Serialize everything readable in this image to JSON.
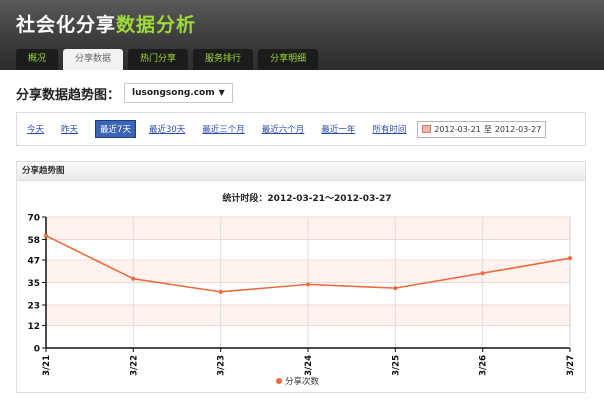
{
  "header": {
    "brand_part1": "社会化分享",
    "brand_part2": "数据分析",
    "tabs": [
      {
        "label": "概况"
      },
      {
        "label": "分享数据"
      },
      {
        "label": "热门分享"
      },
      {
        "label": "服务排行"
      },
      {
        "label": "分享明细"
      }
    ],
    "active_tab": "分享数据"
  },
  "title_row": {
    "title": "分享数据趋势图：",
    "site_selected": "lusongsong.com",
    "caret": "▼"
  },
  "filters": {
    "ranges": [
      "今天",
      "昨天",
      "最近7天",
      "最近30天",
      "最近三个月",
      "最近六个月",
      "最近一年",
      "所有时间"
    ],
    "active_range": "最近7天",
    "date_from": "2012-03-21",
    "date_to_label": "至",
    "date_to": "2012-03-27"
  },
  "panel": {
    "title": "分享趋势图"
  },
  "colors": {
    "accent_green": "#9ed93a",
    "line": "#ee6a3a",
    "band": "#fff2ef",
    "active_range_bg": "#3b64b4"
  },
  "chart_data": {
    "type": "line",
    "title": "统计时段：2012-03-21～2012-03-27",
    "categories": [
      "3/21",
      "3/22",
      "3/23",
      "3/24",
      "3/25",
      "3/26",
      "3/27"
    ],
    "series": [
      {
        "name": "分享次数",
        "values": [
          60,
          37,
          30,
          34,
          32,
          40,
          48
        ]
      }
    ],
    "yticks": [
      0,
      12,
      23,
      35,
      47,
      58,
      70
    ],
    "ylim": [
      0,
      70
    ],
    "grid": true,
    "legend": "bottom-center"
  }
}
